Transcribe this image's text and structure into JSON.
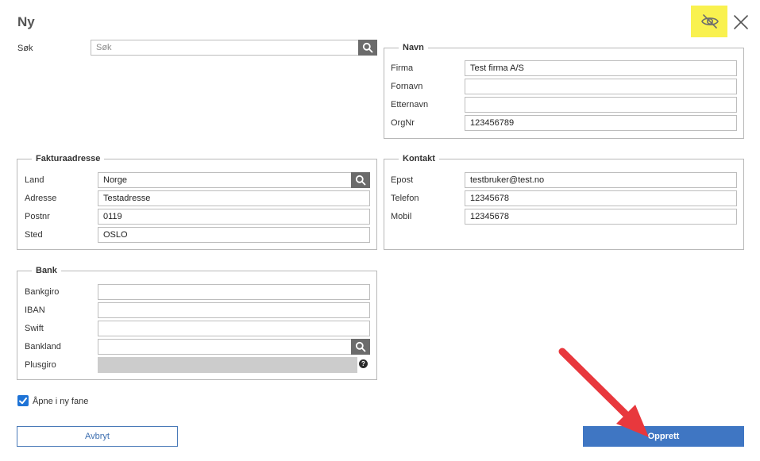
{
  "dialog": {
    "title": "Ny"
  },
  "search": {
    "label": "Søk",
    "placeholder": "Søk"
  },
  "navn": {
    "legend": "Navn",
    "fields": [
      {
        "label": "Firma",
        "value": "Test firma A/S"
      },
      {
        "label": "Fornavn",
        "value": ""
      },
      {
        "label": "Etternavn",
        "value": ""
      },
      {
        "label": "OrgNr",
        "value": "123456789"
      }
    ]
  },
  "faktura": {
    "legend": "Fakturaadresse",
    "fields": [
      {
        "label": "Land",
        "value": "Norge"
      },
      {
        "label": "Adresse",
        "value": "Testadresse"
      },
      {
        "label": "Postnr",
        "value": "0119"
      },
      {
        "label": "Sted",
        "value": "OSLO"
      }
    ]
  },
  "kontakt": {
    "legend": "Kontakt",
    "fields": [
      {
        "label": "Epost",
        "value": "testbruker@test.no"
      },
      {
        "label": "Telefon",
        "value": "12345678"
      },
      {
        "label": "Mobil",
        "value": "12345678"
      }
    ]
  },
  "bank": {
    "legend": "Bank",
    "fields": [
      {
        "label": "Bankgiro",
        "value": ""
      },
      {
        "label": "IBAN",
        "value": ""
      },
      {
        "label": "Swift",
        "value": ""
      },
      {
        "label": "Bankland",
        "value": ""
      },
      {
        "label": "Plusgiro",
        "value": ""
      }
    ],
    "help": "?"
  },
  "open_new_tab": {
    "label": "Åpne i ny fane",
    "checked": true
  },
  "buttons": {
    "cancel": "Avbryt",
    "create": "Opprett"
  },
  "icons": {
    "hide": "eye-slash-icon",
    "close": "close-icon",
    "search": "search-icon",
    "help": "help-icon",
    "check": "checkmark-icon",
    "annotation": "red-arrow-annotation"
  },
  "colors": {
    "highlight": "#f9f14f",
    "primary": "#3f76c3",
    "search_button": "#6b6b6b",
    "checkbox": "#1e73d6",
    "arrow": "#e8383d"
  }
}
